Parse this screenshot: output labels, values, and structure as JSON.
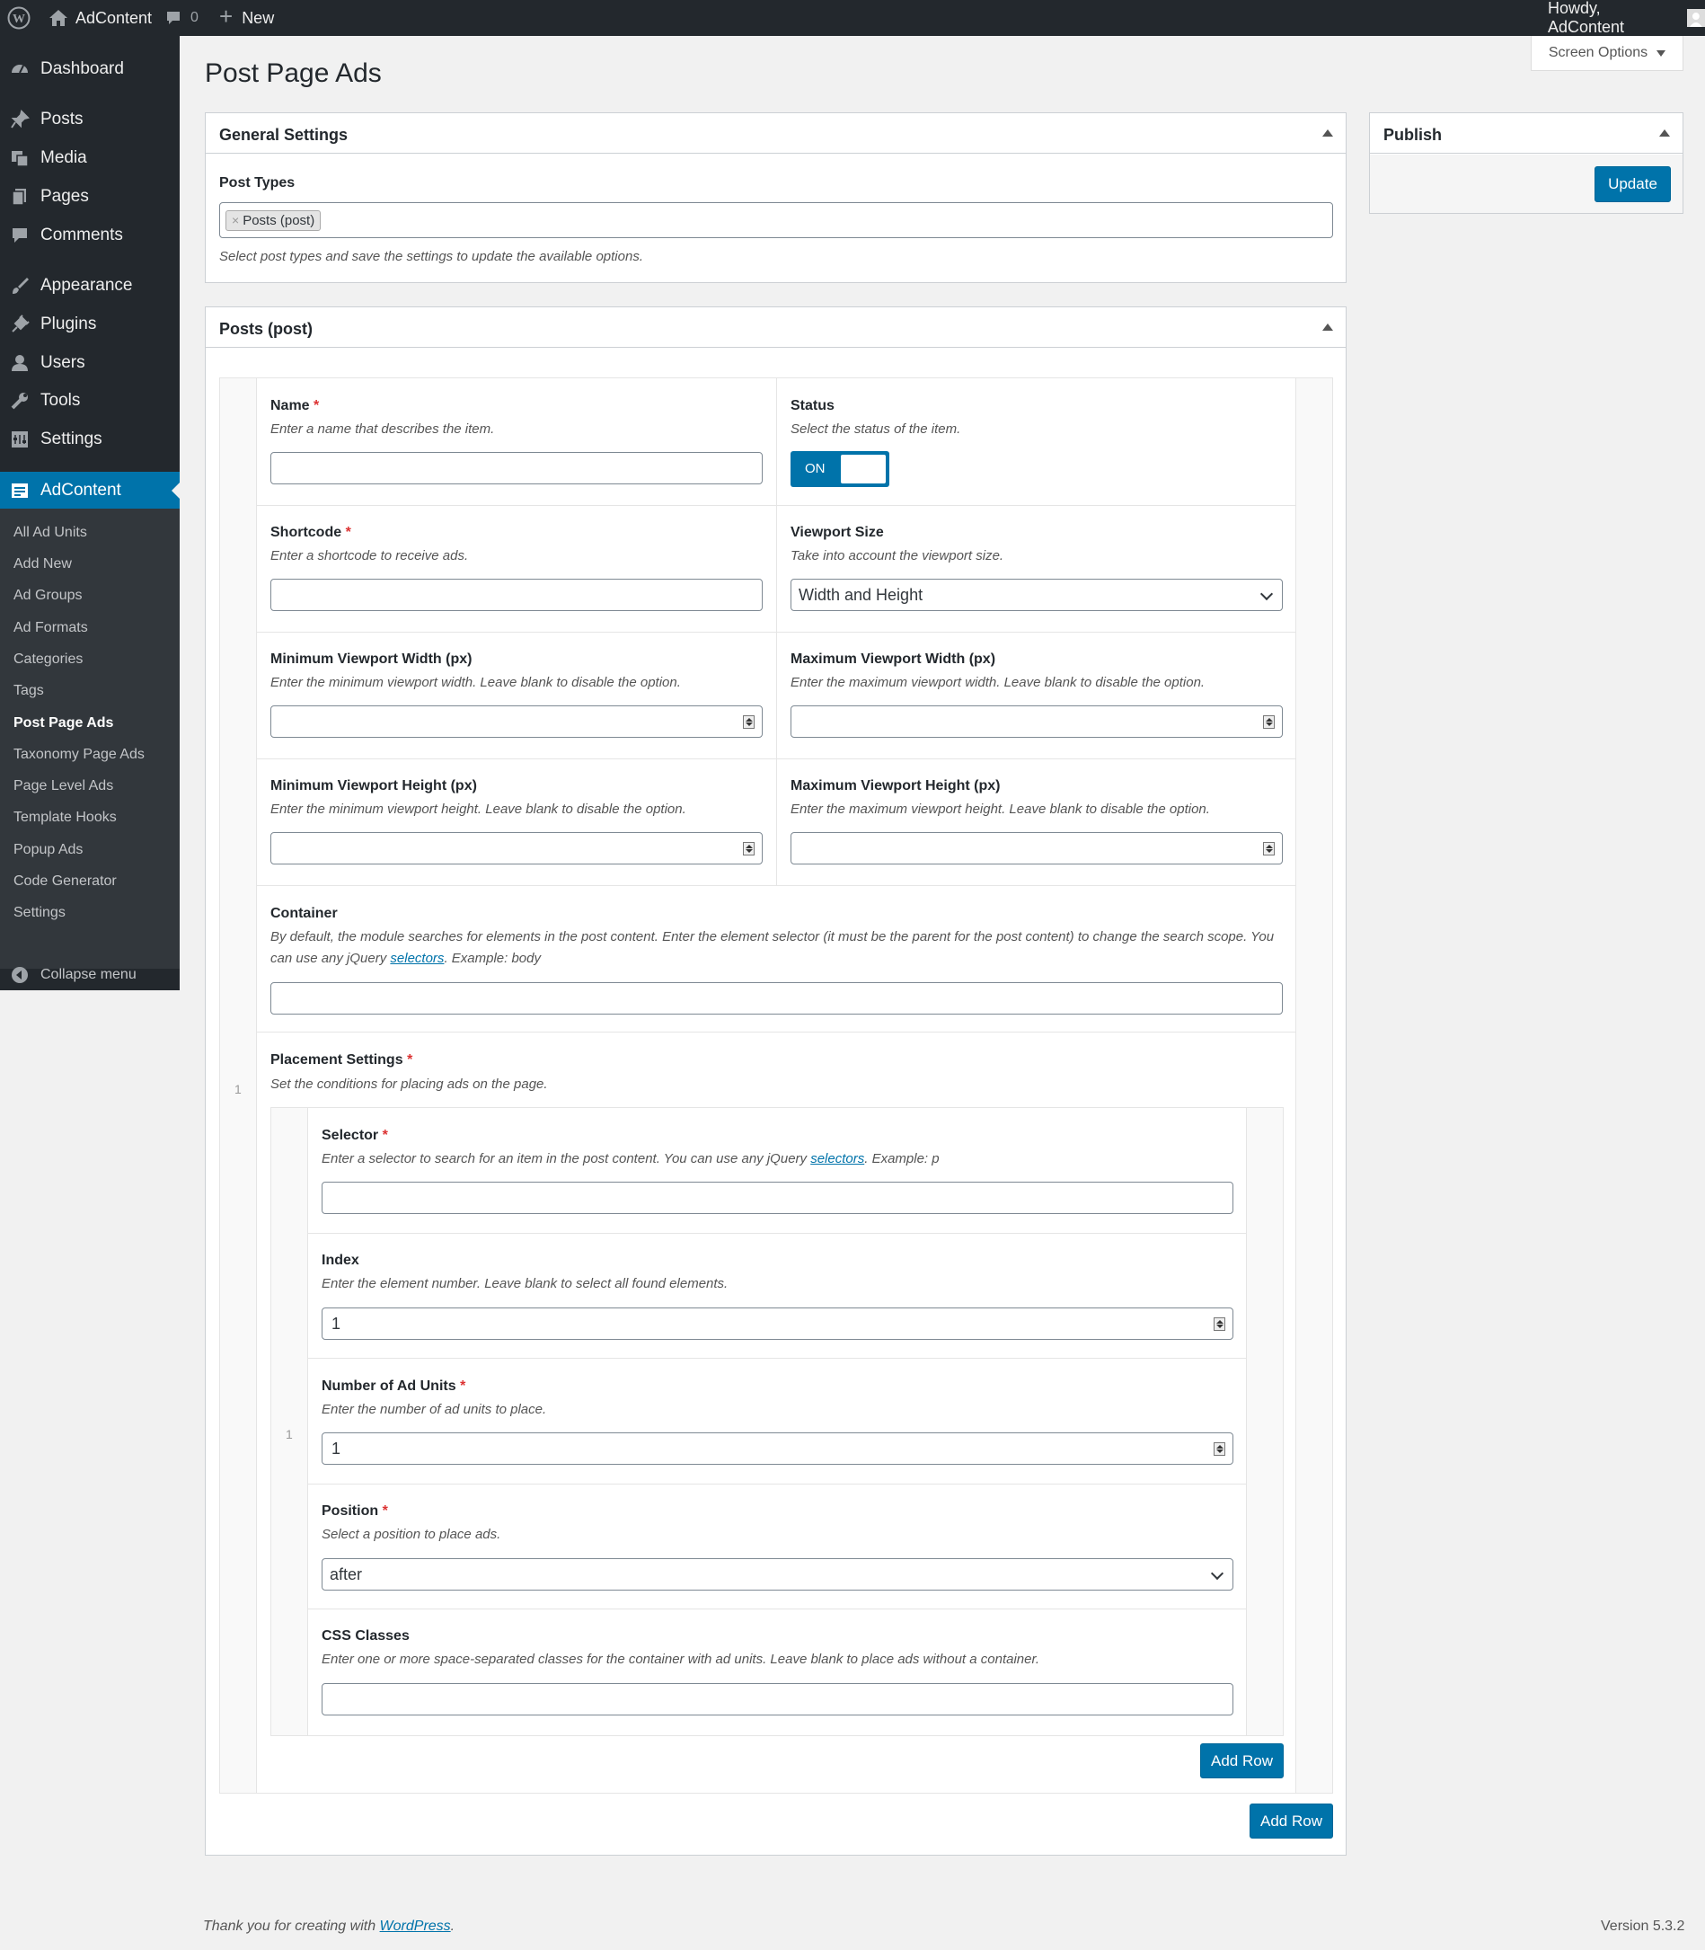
{
  "adminbar": {
    "site_name": "AdContent",
    "comments_count": "0",
    "new_label": "New",
    "howdy": "Howdy, AdContent"
  },
  "sidebar": {
    "items": [
      {
        "label": "Dashboard",
        "icon": "dashboard-icon"
      },
      {
        "label": "Posts",
        "icon": "pushpin-icon"
      },
      {
        "label": "Media",
        "icon": "media-icon"
      },
      {
        "label": "Pages",
        "icon": "pages-icon"
      },
      {
        "label": "Comments",
        "icon": "comment-icon"
      },
      {
        "label": "Appearance",
        "icon": "paintbrush-icon"
      },
      {
        "label": "Plugins",
        "icon": "plug-icon"
      },
      {
        "label": "Users",
        "icon": "user-icon"
      },
      {
        "label": "Tools",
        "icon": "wrench-icon"
      },
      {
        "label": "Settings",
        "icon": "settings-icon"
      },
      {
        "label": "AdContent",
        "icon": "adcontent-icon"
      }
    ],
    "submenu": [
      "All Ad Units",
      "Add New",
      "Ad Groups",
      "Ad Formats",
      "Categories",
      "Tags",
      "Post Page Ads",
      "Taxonomy Page Ads",
      "Page Level Ads",
      "Template Hooks",
      "Popup Ads",
      "Code Generator",
      "Settings"
    ],
    "active_submenu": "Post Page Ads",
    "collapse_label": "Collapse menu"
  },
  "screen_options": "Screen Options",
  "page_title": "Post Page Ads",
  "general_settings": {
    "title": "General Settings",
    "post_types_label": "Post Types",
    "post_types_tag": "Posts (post)",
    "post_types_desc": "Select post types and save the settings to update the available options."
  },
  "publish": {
    "title": "Publish",
    "update_label": "Update"
  },
  "posts_box": {
    "title": "Posts (post)",
    "row_number": "1",
    "name_label": "Name",
    "name_desc": "Enter a name that describes the item.",
    "name_value": "",
    "status_label": "Status",
    "status_desc": "Select the status of the item.",
    "status_toggle": "ON",
    "shortcode_label": "Shortcode",
    "shortcode_desc": "Enter a shortcode to receive ads.",
    "shortcode_value": "",
    "viewport_size_label": "Viewport Size",
    "viewport_size_desc": "Take into account the viewport size.",
    "viewport_size_value": "Width and Height",
    "min_vw_label": "Minimum Viewport Width (px)",
    "min_vw_desc": "Enter the minimum viewport width. Leave blank to disable the option.",
    "max_vw_label": "Maximum Viewport Width (px)",
    "max_vw_desc": "Enter the maximum viewport width. Leave blank to disable the option.",
    "min_vh_label": "Minimum Viewport Height (px)",
    "min_vh_desc": "Enter the minimum viewport height. Leave blank to disable the option.",
    "max_vh_label": "Maximum Viewport Height (px)",
    "max_vh_desc": "Enter the maximum viewport height. Leave blank to disable the option.",
    "container_label": "Container",
    "container_desc_1": "By default, the module searches for elements in the post content. Enter the element selector (it must be the parent for the post content) to change the search scope. You can use any jQuery ",
    "container_desc_link": "selectors",
    "container_desc_2": ". Example: body",
    "placement_label": "Placement Settings",
    "placement_desc": "Set the conditions for placing ads on the page.",
    "add_row_label": "Add Row"
  },
  "placement": {
    "row_number": "1",
    "selector_label": "Selector",
    "selector_desc_1": "Enter a selector to search for an item in the post content. You can use any jQuery ",
    "selector_desc_link": "selectors",
    "selector_desc_2": ". Example: p",
    "index_label": "Index",
    "index_desc": "Enter the element number. Leave blank to select all found elements.",
    "index_value": "1",
    "num_units_label": "Number of Ad Units",
    "num_units_desc": "Enter the number of ad units to place.",
    "num_units_value": "1",
    "position_label": "Position",
    "position_desc": "Select a position to place ads.",
    "position_value": "after",
    "css_label": "CSS Classes",
    "css_desc": "Enter one or more space-separated classes for the container with ad units. Leave blank to place ads without a container.",
    "add_row_label": "Add Row"
  },
  "footer": {
    "thanks_prefix": "Thank you for creating with ",
    "thanks_link": "WordPress",
    "thanks_suffix": ".",
    "version": "Version 5.3.2"
  },
  "colors": {
    "adminbar_bg": "#23282d",
    "sidebar_bg": "#23282d",
    "accent": "#0073aa",
    "required": "#dc3232"
  }
}
